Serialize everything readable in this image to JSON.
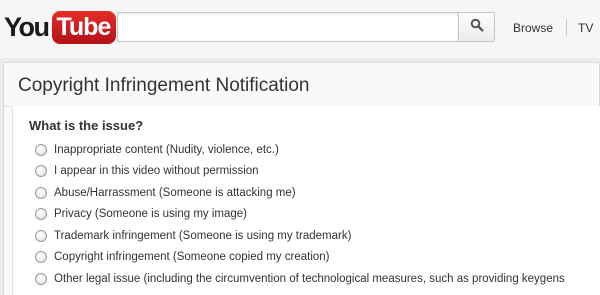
{
  "header": {
    "logo": {
      "you": "You",
      "tube": "Tube",
      "brand_color": "#e52d27"
    },
    "search": {
      "value": "",
      "placeholder": "",
      "button_icon": "magnifier-icon"
    },
    "nav": {
      "browse": "Browse",
      "tv": "TV"
    }
  },
  "page": {
    "title": "Copyright Infringement Notification",
    "question": "What is the issue?",
    "options": [
      "Inappropriate content (Nudity, violence, etc.)",
      "I appear in this video without permission",
      "Abuse/Harrassment (Someone is attacking me)",
      "Privacy (Someone is using my image)",
      "Trademark infringement (Someone is using my trademark)",
      "Copyright infringement (Someone copied my creation)",
      "Other legal issue (including the circumvention of technological measures, such as providing keygens"
    ]
  }
}
